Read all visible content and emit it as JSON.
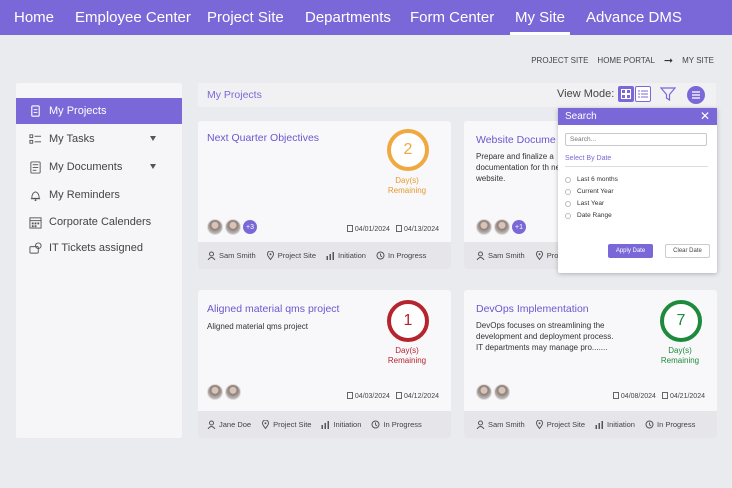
{
  "nav": {
    "items": [
      {
        "label": "Home"
      },
      {
        "label": "Employee Center"
      },
      {
        "label": "Project Site"
      },
      {
        "label": "Departments"
      },
      {
        "label": "Form Center"
      },
      {
        "label": "My Site"
      },
      {
        "label": "Advance DMS"
      }
    ],
    "active": "My Site",
    "color": "#7b68d8"
  },
  "breadcrumb": {
    "site": "PROJECT SITE",
    "portal": "HOME PORTAL",
    "current": "MY SITE"
  },
  "sidebar": {
    "items": [
      {
        "label": "My Projects",
        "icon": "projects-icon",
        "active": true
      },
      {
        "label": "My Tasks",
        "icon": "tasks-icon",
        "expandable": true
      },
      {
        "label": "My Documents",
        "icon": "documents-icon",
        "expandable": true
      },
      {
        "label": "My Reminders",
        "icon": "bell-icon"
      },
      {
        "label": "Corporate Calenders",
        "icon": "calendar-icon"
      },
      {
        "label": "IT Tickets assigned",
        "icon": "tickets-icon"
      }
    ]
  },
  "main": {
    "title": "My Projects",
    "view_mode_label": "View Mode:"
  },
  "projects": [
    {
      "title": "Next Quarter Objectives",
      "description": "",
      "days": "2",
      "days_label_1": "Day(s)",
      "days_label_2": "Remaining",
      "ring_color": "#f0a840",
      "extra_members": "+3",
      "start": "04/01/2024",
      "end": "04/13/2024",
      "owner": "Sam Smith",
      "site": "Project Site",
      "phase": "Initiation",
      "status": "In Progress"
    },
    {
      "title": "Website Docume",
      "description": "Prepare and finalize a documentation for th new website.",
      "extra_members": "+1",
      "owner": "Sam Smith",
      "site": "Projec"
    },
    {
      "title": "Aligned material qms project",
      "description": "Aligned material qms project",
      "days": "1",
      "days_label_1": "Day(s)",
      "days_label_2": "Remaining",
      "ring_color": "#b5252e",
      "start": "04/03/2024",
      "end": "04/12/2024",
      "owner": "Jane Doe",
      "site": "Project Site",
      "phase": "Initiation",
      "status": "In Progress"
    },
    {
      "title": "DevOps Implementation",
      "description": "DevOps focuses on streamlining the development and deployment process. IT departments may manage pro.......",
      "days": "7",
      "days_label_1": "Day(s)",
      "days_label_2": "Remaining",
      "ring_color": "#1e8a3c",
      "start": "04/08/2024",
      "end": "04/21/2024",
      "owner": "Sam Smith",
      "site": "Project Site",
      "phase": "Initiation",
      "status": "In Progress"
    }
  ],
  "search": {
    "title": "Search",
    "placeholder": "Search...",
    "section": "Select By Date",
    "options": [
      "Last 6 months",
      "Current Year",
      "Last Year",
      "Date Range"
    ],
    "apply_label": "Apply Date",
    "clear_label": "Clear Date"
  }
}
